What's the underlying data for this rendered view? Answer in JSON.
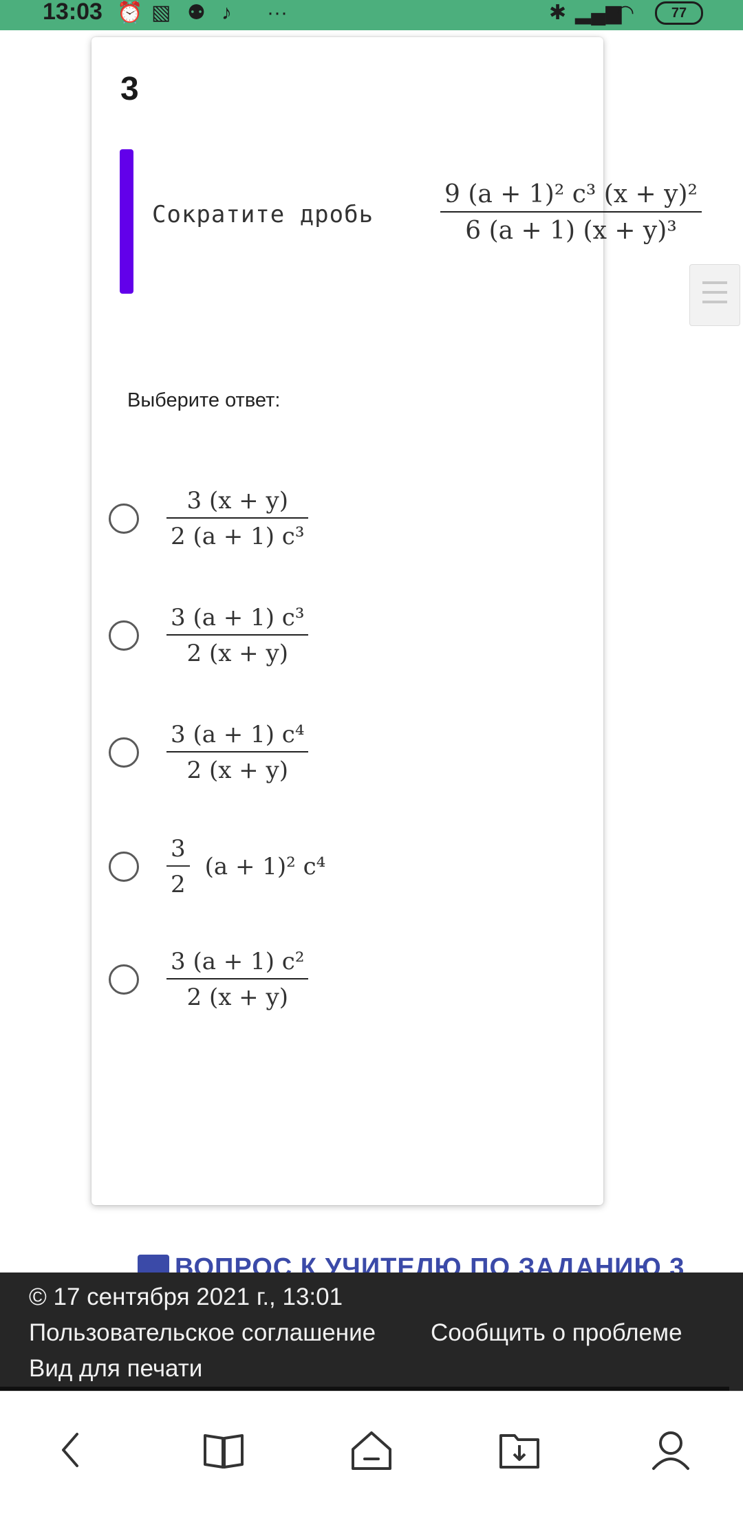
{
  "status_bar": {
    "time": "13:03",
    "icons_left": [
      "alarm-off-icon",
      "gallery-icon",
      "app-icon",
      "tiktok-icon",
      "more-dots-icon"
    ],
    "icons_right": [
      "bluetooth-icon",
      "signal-icon",
      "wifi-icon"
    ],
    "battery": "77"
  },
  "question": {
    "number": "3",
    "text": "Сократите дробь",
    "fraction": {
      "numerator": "9 (a + 1)² c³ (x + y)²",
      "denominator": "6 (a + 1) (x + y)³"
    },
    "prompt": "Выберите ответ:"
  },
  "options": [
    {
      "numerator": "3 (x + y)",
      "denominator": "2 (a + 1) c³"
    },
    {
      "numerator": "3 (a + 1) c³",
      "denominator": "2 (x + y)"
    },
    {
      "numerator": "3 (a + 1) c⁴",
      "denominator": "2 (x + y)"
    },
    {
      "numerator": "3",
      "denominator": "2",
      "rest": "(a + 1)² c⁴"
    },
    {
      "numerator": "3 (a + 1) c²",
      "denominator": "2 (x + y)"
    }
  ],
  "teacher_link": "ВОПРОС К УЧИТЕЛЮ ПО ЗАДАНИЮ 3",
  "footer": {
    "copyright": "© 17 сентября 2021 г., 13:01",
    "user_agreement": "Пользовательское соглашение",
    "report_problem": "Сообщить о проблеме",
    "print_view": "Вид для печати"
  },
  "bottom_nav": [
    "back-icon",
    "book-icon",
    "home-icon",
    "downloads-icon",
    "profile-icon"
  ],
  "colors": {
    "status_bar": "#4caf7d",
    "accent": "#6200ea",
    "footer": "#262626",
    "link": "#3b4aa8"
  }
}
